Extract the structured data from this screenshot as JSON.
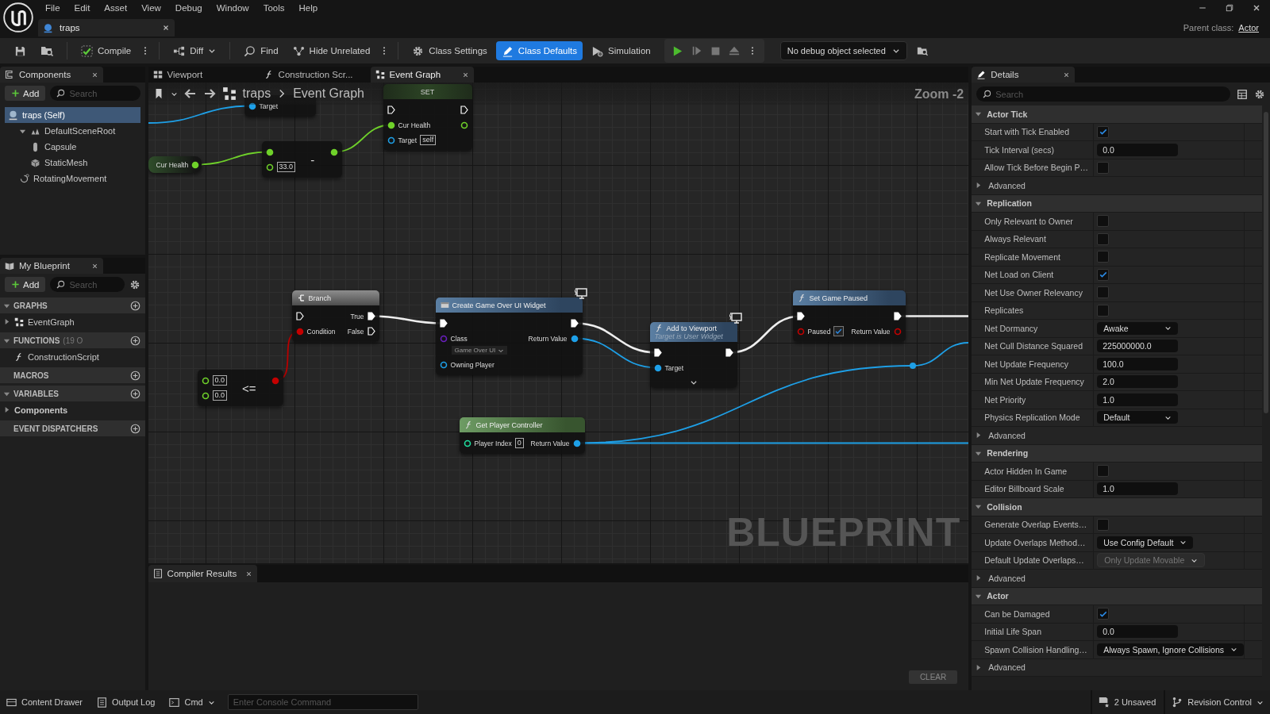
{
  "menu": [
    "File",
    "Edit",
    "Asset",
    "View",
    "Debug",
    "Window",
    "Tools",
    "Help"
  ],
  "document_tab": {
    "title": "traps",
    "selected": true
  },
  "parent_class": {
    "label": "Parent class:",
    "value": "Actor"
  },
  "toolbar": {
    "buttons": [
      {
        "label": "Compile",
        "kind": "split",
        "selected": false
      },
      {
        "label": "Diff",
        "kind": "dropdown",
        "selected": false
      },
      {
        "label": "Find",
        "kind": "button",
        "selected": false
      },
      {
        "label": "Hide Unrelated",
        "kind": "split",
        "selected": false
      },
      {
        "label": "Class Settings",
        "kind": "button",
        "selected": false
      },
      {
        "label": "Class Defaults",
        "kind": "button",
        "selected": true
      },
      {
        "label": "Simulation",
        "kind": "button",
        "selected": false
      }
    ],
    "debug_object": "No debug object selected"
  },
  "components_panel": {
    "title": "Components",
    "add": "Add",
    "search_placeholder": "Search",
    "tree": [
      {
        "label": "traps (Self)",
        "selected": true,
        "children": [
          {
            "label": "DefaultSceneRoot",
            "selected": false,
            "expanded": true,
            "children": [
              {
                "label": "Capsule",
                "selected": false
              },
              {
                "label": "StaticMesh",
                "selected": false
              }
            ]
          },
          {
            "label": "RotatingMovement",
            "selected": false
          }
        ]
      }
    ]
  },
  "my_blueprint": {
    "title": "My Blueprint",
    "add": "Add",
    "search_placeholder": "Search",
    "sections": [
      {
        "title": "GRAPHS",
        "expanded": true,
        "items": [
          {
            "label": "EventGraph",
            "expanded": false
          }
        ]
      },
      {
        "title": "FUNCTIONS",
        "count": "(19 O",
        "expanded": true,
        "items": [
          {
            "label": "ConstructionScript"
          }
        ]
      },
      {
        "title": "MACROS"
      },
      {
        "title": "VARIABLES",
        "expanded": true,
        "items": [
          {
            "label": "Components",
            "expanded": false
          }
        ]
      },
      {
        "title": "EVENT DISPATCHERS"
      }
    ]
  },
  "editor_tabs": [
    {
      "label": "Viewport",
      "selected": false
    },
    {
      "label": "Construction Scr...",
      "selected": false
    },
    {
      "label": "Event Graph",
      "selected": true
    }
  ],
  "graph": {
    "breadcrumb": [
      "traps",
      "Event Graph"
    ],
    "zoom": "Zoom -2",
    "watermark": "BLUEPRINT",
    "nodes": [
      {
        "kind": "function",
        "inputs": [
          {
            "label": "Target",
            "kind": "object",
            "connected": true
          }
        ]
      },
      {
        "kind": "set",
        "title": "SET",
        "inputs": [
          {
            "kind": "exec",
            "connected": false
          },
          {
            "label": "Cur Health",
            "kind": "float",
            "connected": true
          },
          {
            "label": "Target",
            "kind": "object",
            "connected": false,
            "value": "self"
          }
        ],
        "outputs": [
          {
            "kind": "exec",
            "connected": false
          },
          {
            "kind": "float",
            "connected": false
          }
        ]
      },
      {
        "kind": "get",
        "outputs": [
          {
            "label": "Cur Health",
            "kind": "float",
            "connected": true
          }
        ]
      },
      {
        "kind": "operator",
        "operator": "-",
        "inputs": [
          {
            "kind": "float",
            "connected": true
          },
          {
            "kind": "float",
            "connected": false,
            "value": "33.0"
          }
        ],
        "outputs": [
          {
            "kind": "float",
            "connected": true
          }
        ]
      },
      {
        "kind": "branch",
        "title": "Branch",
        "inputs": [
          {
            "kind": "exec",
            "connected": false
          },
          {
            "label": "Condition",
            "kind": "bool",
            "connected": true
          }
        ],
        "outputs": [
          {
            "label": "True",
            "kind": "exec",
            "connected": true
          },
          {
            "label": "False",
            "kind": "exec",
            "connected": false
          }
        ]
      },
      {
        "kind": "operator",
        "operator": "<=",
        "inputs": [
          {
            "kind": "float",
            "connected": false,
            "value": "0.0"
          },
          {
            "kind": "float",
            "connected": false,
            "value": "0.0"
          }
        ],
        "outputs": [
          {
            "kind": "bool",
            "connected": true
          }
        ]
      },
      {
        "kind": "function",
        "title": "Create Game Over UI Widget",
        "client_only": true,
        "advanced_pins": false,
        "inputs": [
          {
            "kind": "exec",
            "connected": true
          },
          {
            "label": "Class",
            "kind": "class",
            "connected": false,
            "value": "Game Over UI"
          },
          {
            "label": "Owning Player",
            "kind": "object",
            "connected": false
          }
        ],
        "outputs": [
          {
            "kind": "exec",
            "connected": true
          },
          {
            "label": "Return Value",
            "kind": "object",
            "connected": true
          }
        ]
      },
      {
        "kind": "function",
        "title": "Add to Viewport",
        "subtitle": "Target is User Widget",
        "client_only": true,
        "advanced_pins": true,
        "inputs": [
          {
            "kind": "exec",
            "connected": true
          },
          {
            "label": "Target",
            "kind": "object",
            "connected": true
          }
        ],
        "outputs": [
          {
            "kind": "exec",
            "connected": true
          }
        ]
      },
      {
        "kind": "function",
        "title": "Set Game Paused",
        "client_only": false,
        "advanced_pins": false,
        "inputs": [
          {
            "kind": "exec",
            "connected": true
          },
          {
            "label": "Paused",
            "kind": "bool",
            "connected": false,
            "checked": true
          }
        ],
        "outputs": [
          {
            "kind": "exec",
            "connected": true
          },
          {
            "label": "Return Value",
            "kind": "bool",
            "connected": false
          }
        ]
      },
      {
        "kind": "pure",
        "title": "Get Player Controller",
        "client_only": false,
        "advanced_pins": false,
        "inputs": [
          {
            "label": "Player Index",
            "kind": "int",
            "connected": false,
            "value": "0"
          }
        ],
        "outputs": [
          {
            "label": "Return Value",
            "kind": "object",
            "connected": true
          }
        ]
      }
    ]
  },
  "compiler_results": {
    "title": "Compiler Results",
    "clear": "CLEAR"
  },
  "details": {
    "title": "Details",
    "search_placeholder": "Search",
    "sections": [
      {
        "title": "Actor Tick",
        "expanded": true,
        "rows": [
          {
            "kind": "check",
            "label": "Start with Tick Enabled",
            "checked": true
          },
          {
            "kind": "number",
            "label": "Tick Interval (secs)",
            "value": "0.0"
          },
          {
            "kind": "check",
            "label": "Allow Tick Before Begin P…",
            "checked": false
          },
          {
            "kind": "advanced",
            "label": "Advanced",
            "expanded": false
          }
        ]
      },
      {
        "title": "Replication",
        "expanded": true,
        "rows": [
          {
            "kind": "check",
            "label": "Only Relevant to Owner",
            "checked": false
          },
          {
            "kind": "check",
            "label": "Always Relevant",
            "checked": false
          },
          {
            "kind": "check",
            "label": "Replicate Movement",
            "checked": false
          },
          {
            "kind": "check",
            "label": "Net Load on Client",
            "checked": true
          },
          {
            "kind": "check",
            "label": "Net Use Owner Relevancy",
            "checked": false
          },
          {
            "kind": "check",
            "label": "Replicates",
            "checked": false
          },
          {
            "kind": "dropdown",
            "label": "Net Dormancy",
            "value": "Awake",
            "disabled": false
          },
          {
            "kind": "number",
            "label": "Net Cull Distance Squared",
            "value": "225000000.0"
          },
          {
            "kind": "number",
            "label": "Net Update Frequency",
            "value": "100.0"
          },
          {
            "kind": "number",
            "label": "Min Net Update Frequency",
            "value": "2.0"
          },
          {
            "kind": "number",
            "label": "Net Priority",
            "value": "1.0"
          },
          {
            "kind": "dropdown",
            "label": "Physics Replication Mode",
            "value": "Default",
            "disabled": false
          },
          {
            "kind": "advanced",
            "label": "Advanced",
            "expanded": false
          }
        ]
      },
      {
        "title": "Rendering",
        "expanded": true,
        "rows": [
          {
            "kind": "check",
            "label": "Actor Hidden In Game",
            "checked": false
          },
          {
            "kind": "number",
            "label": "Editor Billboard Scale",
            "value": "1.0"
          }
        ]
      },
      {
        "title": "Collision",
        "expanded": true,
        "rows": [
          {
            "kind": "check",
            "label": "Generate Overlap Events…",
            "checked": false
          },
          {
            "kind": "dropdown",
            "label": "Update Overlaps Method…",
            "value": "Use Config Default",
            "disabled": false
          },
          {
            "kind": "dropdown",
            "label": "Default Update Overlaps…",
            "value": "Only Update Movable",
            "disabled": true
          },
          {
            "kind": "advanced",
            "label": "Advanced",
            "expanded": false
          }
        ]
      },
      {
        "title": "Actor",
        "expanded": true,
        "rows": [
          {
            "kind": "check",
            "label": "Can be Damaged",
            "checked": true
          },
          {
            "kind": "number",
            "label": "Initial Life Span",
            "value": "0.0"
          },
          {
            "kind": "dropdown",
            "label": "Spawn Collision Handling…",
            "value": "Always Spawn, Ignore Collisions",
            "disabled": false
          },
          {
            "kind": "advanced",
            "label": "Advanced",
            "expanded": false
          }
        ]
      }
    ]
  },
  "status_bar": {
    "buttons": [
      "Content Drawer",
      "Output Log"
    ],
    "cmd": "Cmd",
    "console_placeholder": "Enter Console Command",
    "unsaved": "2 Unsaved",
    "revision_control": "Revision Control"
  }
}
